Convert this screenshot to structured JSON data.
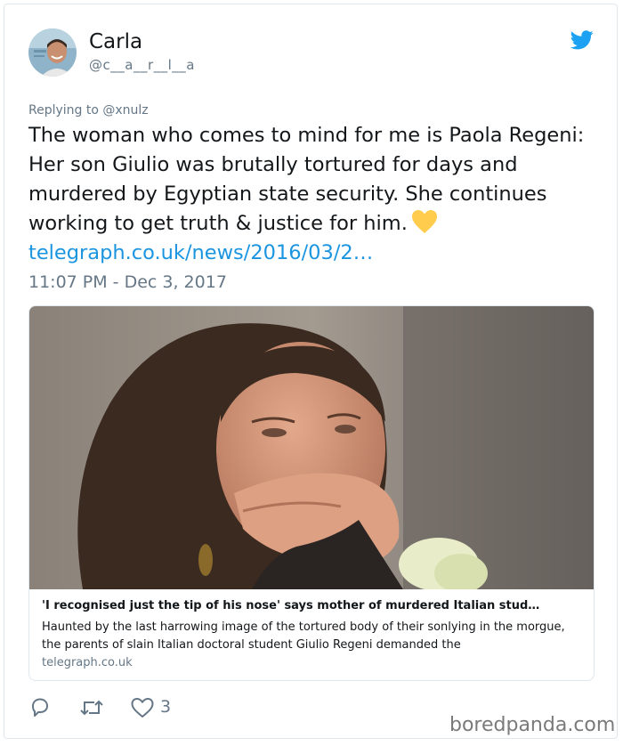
{
  "tweet": {
    "display_name": "Carla",
    "handle": "@c__a__r__l__a",
    "replying_to": "Replying to @xnulz",
    "text": "The woman who comes to mind for me is Paola Regeni: Her son Giulio was brutally tortured for days and murdered by Egyptian state security. She continues working to get truth & justice for him.",
    "emoji_name": "yellow-heart",
    "link_text": "telegraph.co.uk/news/2016/03/2…",
    "timestamp": "11:07 PM - Dec 3, 2017"
  },
  "card": {
    "title": "'I recognised just the tip of his nose' says mother of murdered Italian stud…",
    "description": "Haunted by the last harrowing image of the tortured body of their sonlying in the morgue, the parents of slain Italian doctoral student Giulio Regeni demanded the",
    "domain": "telegraph.co.uk"
  },
  "actions": {
    "reply_icon": "reply-icon",
    "retweet_icon": "retweet-icon",
    "like_icon": "heart-icon",
    "like_count": "3"
  },
  "watermark": "boredpanda.com",
  "colors": {
    "link": "#1b95e0",
    "secondary_text": "#657786",
    "twitter_blue": "#1da1f2",
    "emoji_yellow": "#ffcc4d"
  }
}
